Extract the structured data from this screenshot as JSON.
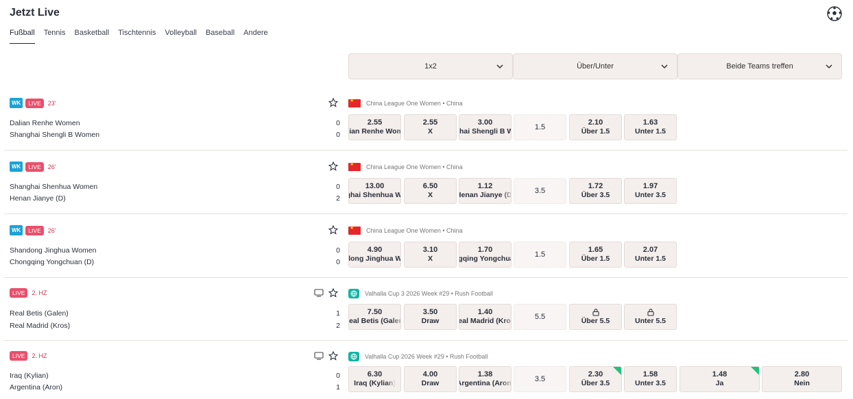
{
  "header": {
    "title": "Jetzt Live"
  },
  "icons": {
    "sport": "soccer-ball-icon",
    "favorite": "star-icon",
    "stream": "tv-icon",
    "locked": "lock-icon",
    "expand": "chevron-down-icon",
    "region": "globe-icon",
    "country": "china-flag-icon"
  },
  "colors": {
    "live_badge": "#e94f6b",
    "wk_badge": "#1aa3d8",
    "odds_bg": "#f4eeec",
    "boost_corner": "#22c27a",
    "time": "#d0334d"
  },
  "tabs": [
    "Fußball",
    "Tennis",
    "Basketball",
    "Tischtennis",
    "Volleyball",
    "Baseball",
    "Andere"
  ],
  "market_headers": [
    "1x2",
    "Über/Unter",
    "Beide Teams treffen"
  ],
  "matches": [
    {
      "wk": "WK",
      "live": "LIVE",
      "time": "23'",
      "league": "China League One Women • China",
      "home": "Dalian Renhe Women",
      "away": "Shanghai Shengli B Women",
      "home_score": "0",
      "away_score": "0",
      "odds_1x2": [
        {
          "odd": "2.55",
          "label": "Dalian Renhe Women"
        },
        {
          "odd": "2.55",
          "label": "X"
        },
        {
          "odd": "3.00",
          "label": "Shanghai Shengli B Women"
        }
      ],
      "line": "1.5",
      "over": {
        "odd": "2.10",
        "label": "Über 1.5"
      },
      "under": {
        "odd": "1.63",
        "label": "Unter 1.5"
      }
    },
    {
      "wk": "WK",
      "live": "LIVE",
      "time": "26'",
      "league": "China League One Women • China",
      "home": "Shanghai Shenhua Women",
      "away": "Henan Jianye (D)",
      "home_score": "0",
      "away_score": "2",
      "odds_1x2": [
        {
          "odd": "13.00",
          "label": "Shanghai Shenhua Women"
        },
        {
          "odd": "6.50",
          "label": "X"
        },
        {
          "odd": "1.12",
          "label": "Henan Jianye (D)"
        }
      ],
      "line": "3.5",
      "over": {
        "odd": "1.72",
        "label": "Über 3.5"
      },
      "under": {
        "odd": "1.97",
        "label": "Unter 3.5"
      }
    },
    {
      "wk": "WK",
      "live": "LIVE",
      "time": "26'",
      "league": "China League One Women • China",
      "home": "Shandong Jinghua Women",
      "away": "Chongqing Yongchuan (D)",
      "home_score": "0",
      "away_score": "0",
      "odds_1x2": [
        {
          "odd": "4.90",
          "label": "Shandong Jinghua Women"
        },
        {
          "odd": "3.10",
          "label": "X"
        },
        {
          "odd": "1.70",
          "label": "Chongqing Yongchuan (D)"
        }
      ],
      "line": "1.5",
      "over": {
        "odd": "1.65",
        "label": "Über 1.5"
      },
      "under": {
        "odd": "2.07",
        "label": "Unter 1.5"
      }
    },
    {
      "live": "LIVE",
      "time": "2. HZ",
      "league": "Valhalla Cup 3 2026 Week #29 • Rush Football",
      "home": "Real Betis (Galen)",
      "away": "Real Madrid (Kros)",
      "home_score": "1",
      "away_score": "2",
      "odds_1x2": [
        {
          "odd": "7.50",
          "label": "Real Betis (Galen)"
        },
        {
          "odd": "3.50",
          "label": "Draw"
        },
        {
          "odd": "1.40",
          "label": "Real Madrid (Kros)"
        }
      ],
      "line": "5.5",
      "over": {
        "label": "Über 5.5"
      },
      "under": {
        "label": "Unter 5.5"
      }
    },
    {
      "live": "LIVE",
      "time": "2. HZ",
      "league": "Valhalla Cup 2026 Week #29 • Rush Football",
      "home": "Iraq (Kylian)",
      "away": "Argentina (Aron)",
      "home_score": "0",
      "away_score": "1",
      "odds_1x2": [
        {
          "odd": "6.30",
          "label": "Iraq (Kylian)"
        },
        {
          "odd": "4.00",
          "label": "Draw"
        },
        {
          "odd": "1.38",
          "label": "Argentina (Aron)"
        }
      ],
      "line": "3.5",
      "over": {
        "odd": "2.30",
        "label": "Über 3.5"
      },
      "under": {
        "odd": "1.58",
        "label": "Unter 3.5"
      },
      "btts": [
        {
          "odd": "1.48",
          "label": "Ja"
        },
        {
          "odd": "2.80",
          "label": "Nein"
        }
      ]
    }
  ]
}
